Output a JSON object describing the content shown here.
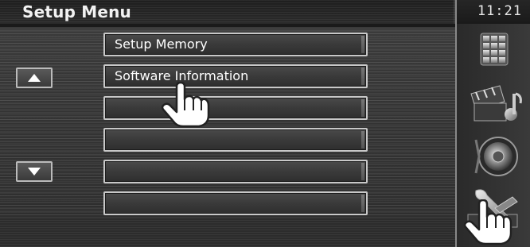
{
  "header": {
    "title": "Setup Menu",
    "clock": "11:21"
  },
  "menu": {
    "items": [
      {
        "label": "Setup Memory"
      },
      {
        "label": "Software Information"
      },
      {
        "label": ""
      },
      {
        "label": ""
      },
      {
        "label": ""
      },
      {
        "label": ""
      }
    ]
  },
  "scroll": {
    "up_icon": "triangle-up-icon",
    "down_icon": "triangle-down-icon"
  },
  "side_nav": {
    "items": [
      {
        "icon": "keypad-icon"
      },
      {
        "icon": "media-icon"
      },
      {
        "icon": "speaker-icon"
      },
      {
        "icon": "tools-icon"
      }
    ]
  },
  "colors": {
    "background": "#333333",
    "button_border": "#c8c8c8",
    "text": "#ffffff"
  }
}
